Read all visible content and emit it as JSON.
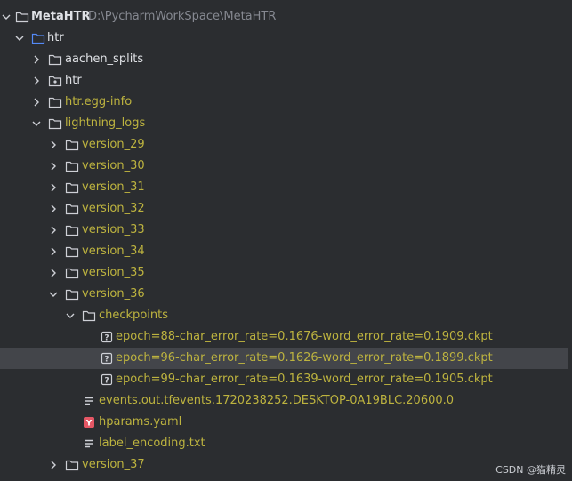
{
  "project": {
    "name": "MetaHTR",
    "path": "D:\\PycharmWorkSpace\\MetaHTR"
  },
  "tree": {
    "htr": "htr",
    "aachen_splits": "aachen_splits",
    "htr_module": "htr",
    "htr_egg_info": "htr.egg-info",
    "lightning_logs": "lightning_logs",
    "versions": [
      "version_29",
      "version_30",
      "version_31",
      "version_32",
      "version_33",
      "version_34",
      "version_35",
      "version_36"
    ],
    "checkpoints": "checkpoints",
    "ckpt_files": [
      "epoch=88-char_error_rate=0.1676-word_error_rate=0.1909.ckpt",
      "epoch=96-char_error_rate=0.1626-word_error_rate=0.1899.ckpt",
      "epoch=99-char_error_rate=0.1639-word_error_rate=0.1905.ckpt"
    ],
    "events_file": "events.out.tfevents.1720238252.DESKTOP-0A19BLC.20600.0",
    "hparams_file": "hparams.yaml",
    "label_file": "label_encoding.txt",
    "version_37": "version_37"
  },
  "selected_file": "epoch=96-char_error_rate=0.1626-word_error_rate=0.1899.ckpt",
  "watermark": "CSDN @猫精灵",
  "colors": {
    "background": "#2b2d30",
    "selection": "#43454a",
    "excluded_text": "#bdb33f",
    "text": "#dfe1e5",
    "folder_blue": "#548af7"
  },
  "icons": {
    "chevron_right": "chevron-right-icon",
    "chevron_down": "chevron-down-icon",
    "folder": "folder-icon",
    "unknown_file": "unknown-file-icon",
    "text_file": "text-file-icon",
    "yaml_file": "yaml-file-icon"
  }
}
